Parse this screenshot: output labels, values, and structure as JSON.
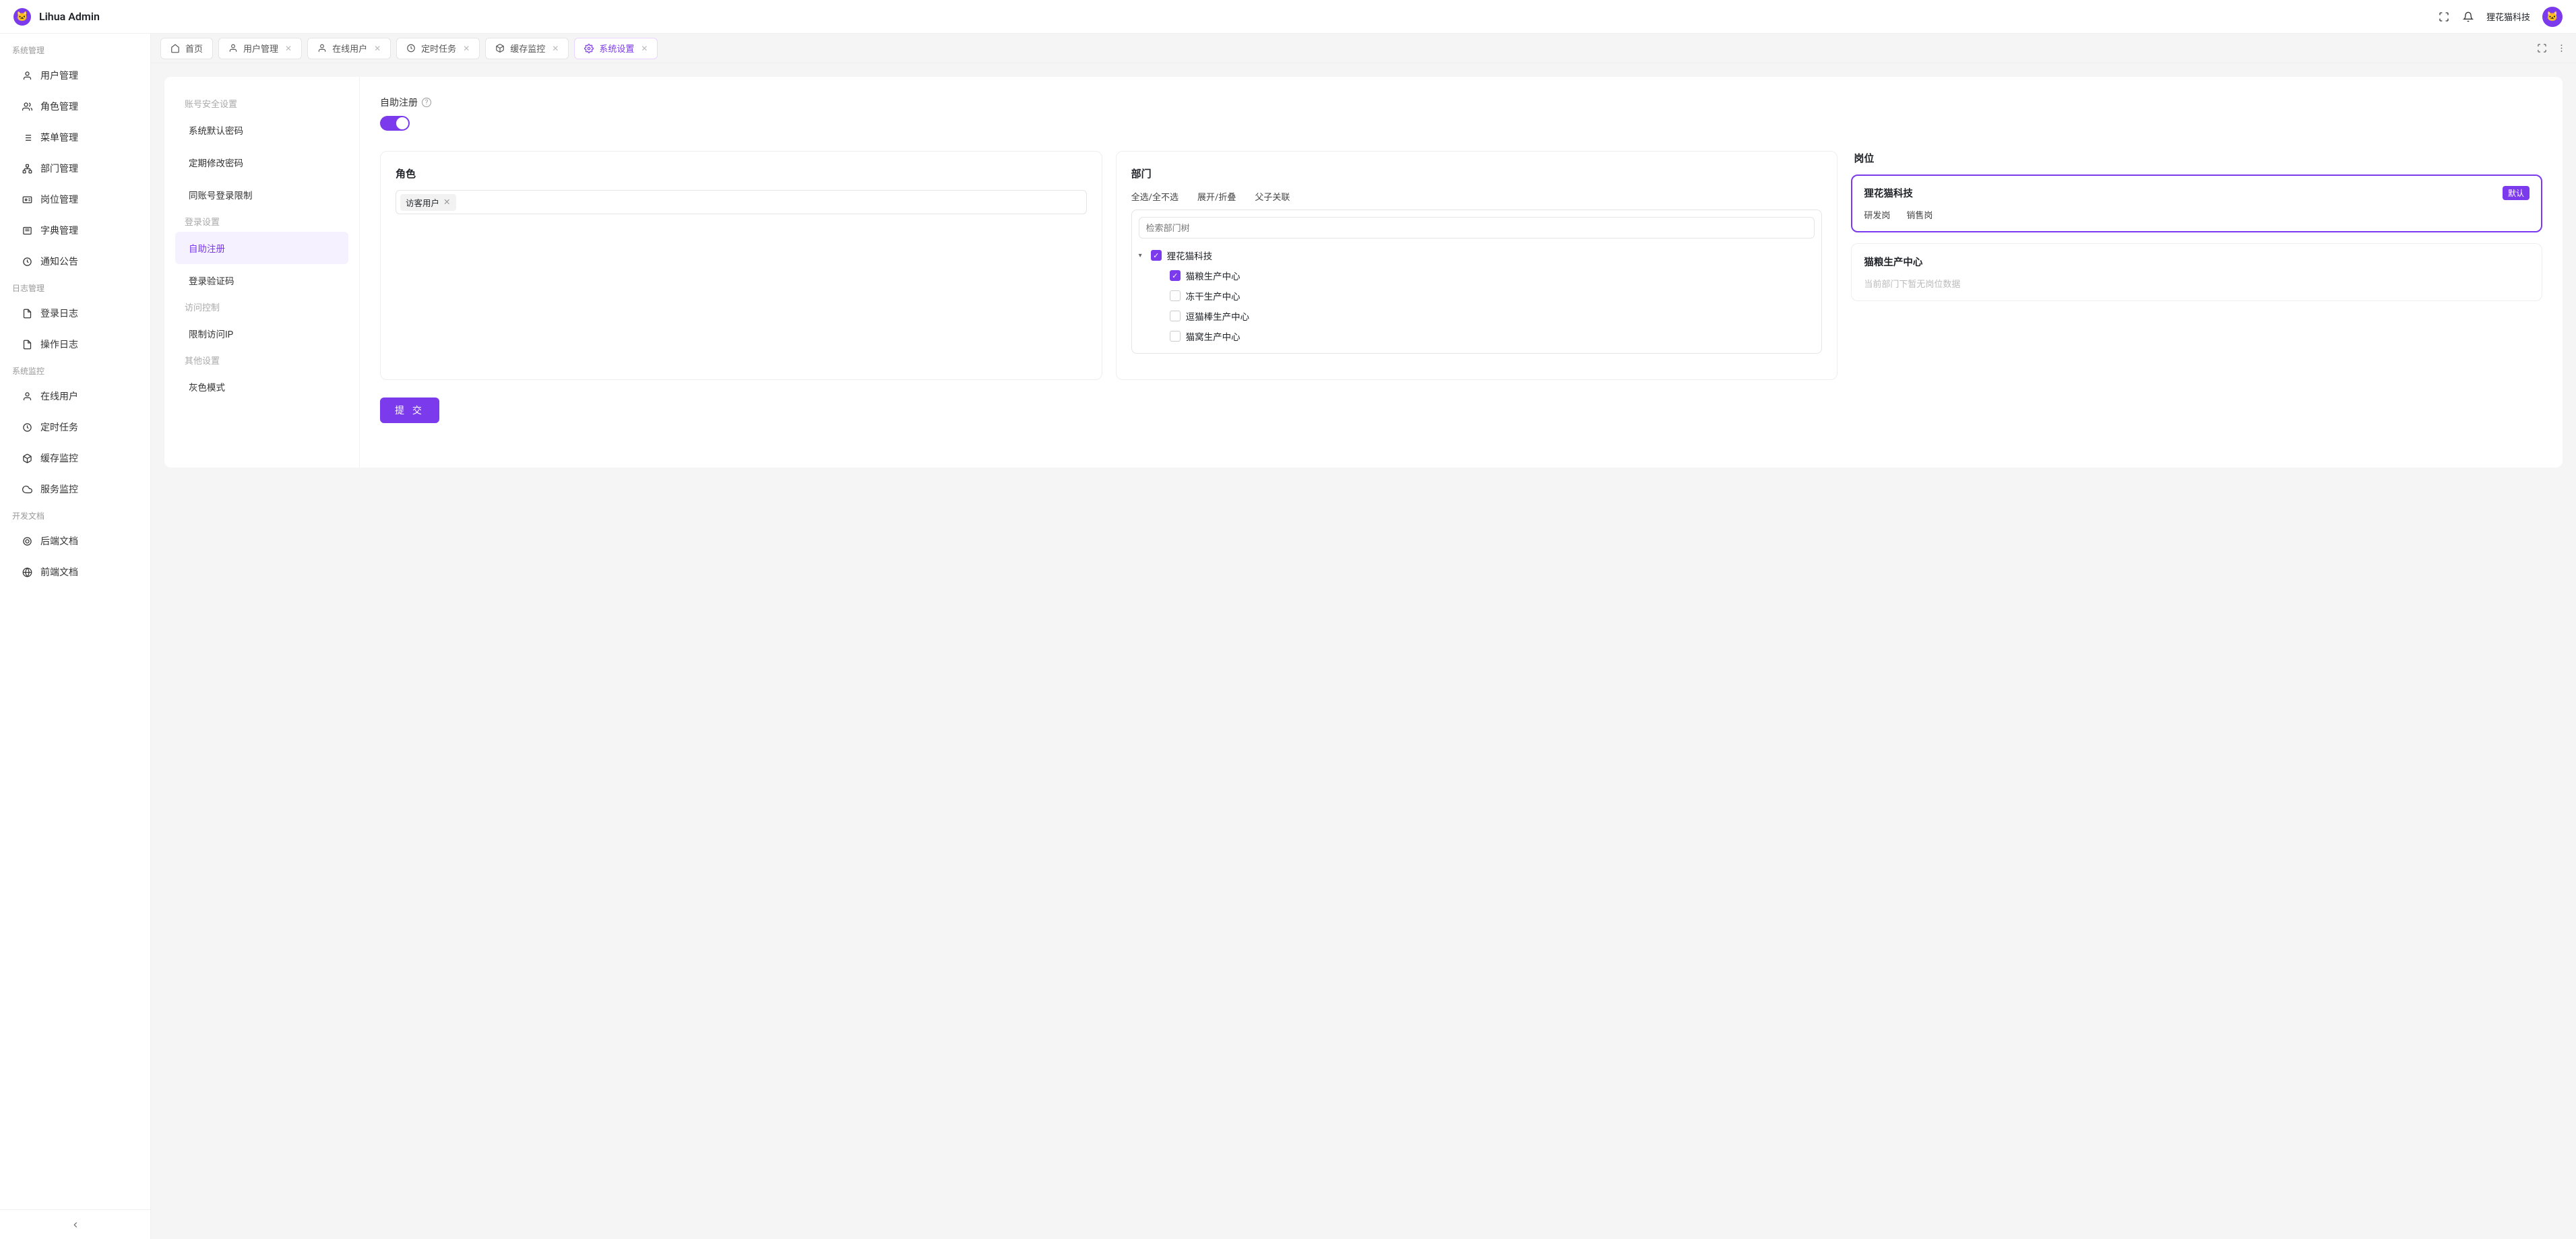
{
  "brand": {
    "name": "Lihua Admin",
    "logo_emoji": "🐱"
  },
  "header": {
    "user_name": "狸花猫科技",
    "avatar_emoji": "🐱"
  },
  "sidebar": {
    "groups": [
      {
        "title": "系统管理",
        "items": [
          {
            "label": "用户管理",
            "icon": "user"
          },
          {
            "label": "角色管理",
            "icon": "role"
          },
          {
            "label": "菜单管理",
            "icon": "list"
          },
          {
            "label": "部门管理",
            "icon": "tree"
          },
          {
            "label": "岗位管理",
            "icon": "id"
          },
          {
            "label": "字典管理",
            "icon": "book"
          },
          {
            "label": "通知公告",
            "icon": "clock"
          }
        ]
      },
      {
        "title": "日志管理",
        "items": [
          {
            "label": "登录日志",
            "icon": "doc"
          },
          {
            "label": "操作日志",
            "icon": "doc"
          }
        ]
      },
      {
        "title": "系统监控",
        "items": [
          {
            "label": "在线用户",
            "icon": "user"
          },
          {
            "label": "定时任务",
            "icon": "clock"
          },
          {
            "label": "缓存监控",
            "icon": "cube"
          },
          {
            "label": "服务监控",
            "icon": "cloud"
          }
        ]
      },
      {
        "title": "开发文档",
        "items": [
          {
            "label": "后端文档",
            "icon": "ring"
          },
          {
            "label": "前端文档",
            "icon": "globe"
          }
        ]
      }
    ]
  },
  "tabs": [
    {
      "label": "首页",
      "icon": "home",
      "closable": false,
      "active": false
    },
    {
      "label": "用户管理",
      "icon": "user",
      "closable": true,
      "active": false
    },
    {
      "label": "在线用户",
      "icon": "user",
      "closable": true,
      "active": false
    },
    {
      "label": "定时任务",
      "icon": "clock",
      "closable": true,
      "active": false
    },
    {
      "label": "缓存监控",
      "icon": "cube",
      "closable": true,
      "active": false
    },
    {
      "label": "系统设置",
      "icon": "settings",
      "closable": true,
      "active": true
    }
  ],
  "settings_nav": [
    {
      "type": "title",
      "label": "账号安全设置"
    },
    {
      "type": "item",
      "label": "系统默认密码"
    },
    {
      "type": "item",
      "label": "定期修改密码"
    },
    {
      "type": "item",
      "label": "同账号登录限制"
    },
    {
      "type": "title",
      "label": "登录设置"
    },
    {
      "type": "item",
      "label": "自助注册",
      "active": true
    },
    {
      "type": "item",
      "label": "登录验证码"
    },
    {
      "type": "title",
      "label": "访问控制"
    },
    {
      "type": "item",
      "label": "限制访问IP"
    },
    {
      "type": "title",
      "label": "其他设置"
    },
    {
      "type": "item",
      "label": "灰色模式"
    }
  ],
  "form": {
    "self_register_label": "自助注册",
    "self_register_on": true,
    "role": {
      "title": "角色",
      "tags": [
        "访客用户"
      ]
    },
    "dept": {
      "title": "部门",
      "actions": {
        "select_all": "全选/全不选",
        "expand": "展开/折叠",
        "parent": "父子关联"
      },
      "search_placeholder": "检索部门树",
      "tree": {
        "label": "狸花猫科技",
        "checked": true,
        "expanded": true,
        "children": [
          {
            "label": "猫粮生产中心",
            "checked": true
          },
          {
            "label": "冻干生产中心",
            "checked": false
          },
          {
            "label": "逗猫棒生产中心",
            "checked": false
          },
          {
            "label": "猫窝生产中心",
            "checked": false
          }
        ]
      }
    },
    "position": {
      "title": "岗位",
      "cards": [
        {
          "name": "狸花猫科技",
          "default_badge": "默认",
          "selected": true,
          "items": [
            "研发岗",
            "销售岗"
          ]
        },
        {
          "name": "猫粮生产中心",
          "empty_text": "当前部门下暂无岗位数据"
        }
      ]
    },
    "submit_label": "提 交"
  },
  "colors": {
    "primary": "#7c3aed"
  }
}
